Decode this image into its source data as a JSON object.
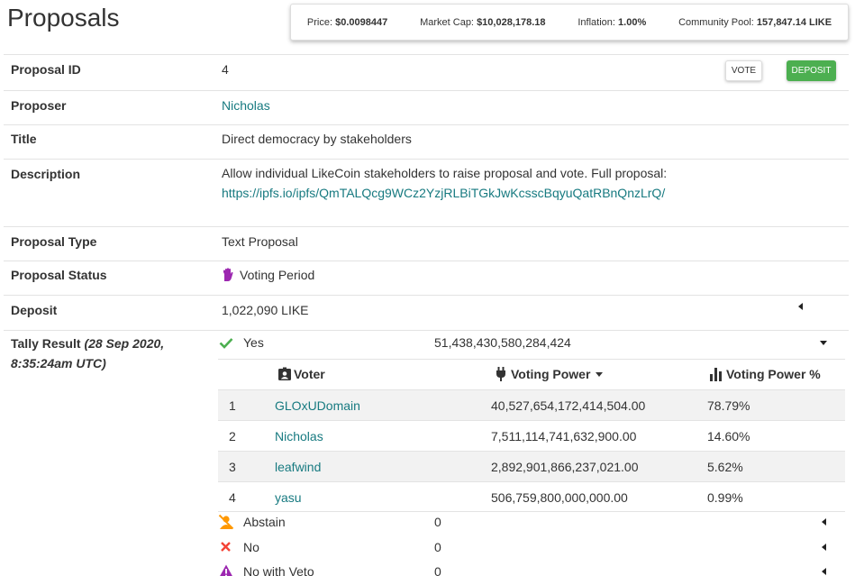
{
  "page": {
    "title": "Proposals"
  },
  "stats": {
    "price_label": "Price:",
    "price_value": "$0.0098447",
    "mcap_label": "Market Cap:",
    "mcap_value": "$10,028,178.18",
    "inflation_label": "Inflation:",
    "inflation_value": "1.00%",
    "pool_label": "Community Pool:",
    "pool_value": "157,847.14 LIKE"
  },
  "actions": {
    "vote": "VOTE",
    "deposit": "DEPOSIT"
  },
  "fields": {
    "proposal_id": {
      "label": "Proposal ID",
      "value": "4"
    },
    "proposer": {
      "label": "Proposer",
      "value": "Nicholas"
    },
    "title": {
      "label": "Title",
      "value": "Direct democracy by stakeholders"
    },
    "description": {
      "label": "Description",
      "text": "Allow individual LikeCoin stakeholders to raise proposal and vote. Full proposal:",
      "link": "https://ipfs.io/ipfs/QmTALQcg9WCz2YzjRLBiTGkJwKcsscBqyuQatRBnQnzLrQ/"
    },
    "type": {
      "label": "Proposal Type",
      "value": "Text Proposal"
    },
    "status": {
      "label": "Proposal Status",
      "value": "Voting Period",
      "icon": "hand-icon"
    },
    "deposit": {
      "label": "Deposit",
      "value": "1,022,090 LIKE"
    },
    "tally": {
      "label": "Tally Result",
      "date": "(28 Sep 2020,",
      "time": "8:35:24am UTC)"
    }
  },
  "tally": [
    {
      "name": "Yes",
      "value": "51,438,430,580,284,424",
      "icon": "check-icon",
      "color": "#4caf50"
    },
    {
      "name": "Abstain",
      "value": "0",
      "icon": "abstain-user-icon",
      "color": "#ff9800"
    },
    {
      "name": "No",
      "value": "0",
      "icon": "x-icon",
      "color": "#f44336"
    },
    {
      "name": "No with Veto",
      "value": "0",
      "icon": "warning-icon",
      "color": "#9c27b0"
    }
  ],
  "voters": {
    "headers": {
      "voter": "Voter",
      "power": "Voting Power",
      "percent": "Voting Power %"
    },
    "rows": [
      {
        "index": "1",
        "name": "GLOxUDomain",
        "power": "40,527,654,172,414,504.00",
        "percent": "78.79%"
      },
      {
        "index": "2",
        "name": "Nicholas",
        "power": "7,511,114,741,632,900.00",
        "percent": "14.60%"
      },
      {
        "index": "3",
        "name": "leafwind",
        "power": "2,892,901,866,237,021.00",
        "percent": "5.62%"
      },
      {
        "index": "4",
        "name": "yasu",
        "power": "506,759,800,000,000.00",
        "percent": "0.99%"
      }
    ]
  }
}
